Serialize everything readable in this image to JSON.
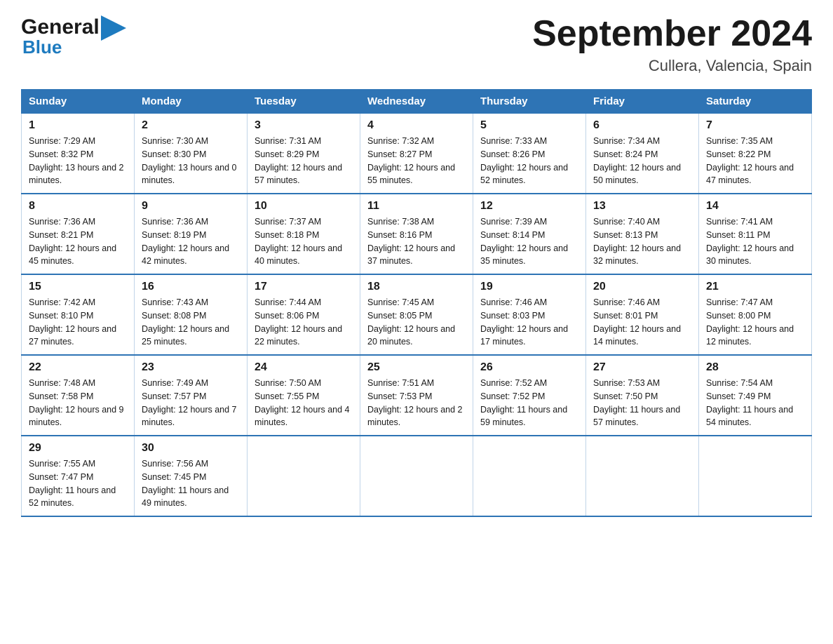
{
  "header": {
    "logo_general": "General",
    "logo_blue": "Blue",
    "title": "September 2024",
    "subtitle": "Cullera, Valencia, Spain"
  },
  "columns": [
    "Sunday",
    "Monday",
    "Tuesday",
    "Wednesday",
    "Thursday",
    "Friday",
    "Saturday"
  ],
  "weeks": [
    [
      {
        "day": "1",
        "sunrise": "7:29 AM",
        "sunset": "8:32 PM",
        "daylight": "13 hours and 2 minutes."
      },
      {
        "day": "2",
        "sunrise": "7:30 AM",
        "sunset": "8:30 PM",
        "daylight": "13 hours and 0 minutes."
      },
      {
        "day": "3",
        "sunrise": "7:31 AM",
        "sunset": "8:29 PM",
        "daylight": "12 hours and 57 minutes."
      },
      {
        "day": "4",
        "sunrise": "7:32 AM",
        "sunset": "8:27 PM",
        "daylight": "12 hours and 55 minutes."
      },
      {
        "day": "5",
        "sunrise": "7:33 AM",
        "sunset": "8:26 PM",
        "daylight": "12 hours and 52 minutes."
      },
      {
        "day": "6",
        "sunrise": "7:34 AM",
        "sunset": "8:24 PM",
        "daylight": "12 hours and 50 minutes."
      },
      {
        "day": "7",
        "sunrise": "7:35 AM",
        "sunset": "8:22 PM",
        "daylight": "12 hours and 47 minutes."
      }
    ],
    [
      {
        "day": "8",
        "sunrise": "7:36 AM",
        "sunset": "8:21 PM",
        "daylight": "12 hours and 45 minutes."
      },
      {
        "day": "9",
        "sunrise": "7:36 AM",
        "sunset": "8:19 PM",
        "daylight": "12 hours and 42 minutes."
      },
      {
        "day": "10",
        "sunrise": "7:37 AM",
        "sunset": "8:18 PM",
        "daylight": "12 hours and 40 minutes."
      },
      {
        "day": "11",
        "sunrise": "7:38 AM",
        "sunset": "8:16 PM",
        "daylight": "12 hours and 37 minutes."
      },
      {
        "day": "12",
        "sunrise": "7:39 AM",
        "sunset": "8:14 PM",
        "daylight": "12 hours and 35 minutes."
      },
      {
        "day": "13",
        "sunrise": "7:40 AM",
        "sunset": "8:13 PM",
        "daylight": "12 hours and 32 minutes."
      },
      {
        "day": "14",
        "sunrise": "7:41 AM",
        "sunset": "8:11 PM",
        "daylight": "12 hours and 30 minutes."
      }
    ],
    [
      {
        "day": "15",
        "sunrise": "7:42 AM",
        "sunset": "8:10 PM",
        "daylight": "12 hours and 27 minutes."
      },
      {
        "day": "16",
        "sunrise": "7:43 AM",
        "sunset": "8:08 PM",
        "daylight": "12 hours and 25 minutes."
      },
      {
        "day": "17",
        "sunrise": "7:44 AM",
        "sunset": "8:06 PM",
        "daylight": "12 hours and 22 minutes."
      },
      {
        "day": "18",
        "sunrise": "7:45 AM",
        "sunset": "8:05 PM",
        "daylight": "12 hours and 20 minutes."
      },
      {
        "day": "19",
        "sunrise": "7:46 AM",
        "sunset": "8:03 PM",
        "daylight": "12 hours and 17 minutes."
      },
      {
        "day": "20",
        "sunrise": "7:46 AM",
        "sunset": "8:01 PM",
        "daylight": "12 hours and 14 minutes."
      },
      {
        "day": "21",
        "sunrise": "7:47 AM",
        "sunset": "8:00 PM",
        "daylight": "12 hours and 12 minutes."
      }
    ],
    [
      {
        "day": "22",
        "sunrise": "7:48 AM",
        "sunset": "7:58 PM",
        "daylight": "12 hours and 9 minutes."
      },
      {
        "day": "23",
        "sunrise": "7:49 AM",
        "sunset": "7:57 PM",
        "daylight": "12 hours and 7 minutes."
      },
      {
        "day": "24",
        "sunrise": "7:50 AM",
        "sunset": "7:55 PM",
        "daylight": "12 hours and 4 minutes."
      },
      {
        "day": "25",
        "sunrise": "7:51 AM",
        "sunset": "7:53 PM",
        "daylight": "12 hours and 2 minutes."
      },
      {
        "day": "26",
        "sunrise": "7:52 AM",
        "sunset": "7:52 PM",
        "daylight": "11 hours and 59 minutes."
      },
      {
        "day": "27",
        "sunrise": "7:53 AM",
        "sunset": "7:50 PM",
        "daylight": "11 hours and 57 minutes."
      },
      {
        "day": "28",
        "sunrise": "7:54 AM",
        "sunset": "7:49 PM",
        "daylight": "11 hours and 54 minutes."
      }
    ],
    [
      {
        "day": "29",
        "sunrise": "7:55 AM",
        "sunset": "7:47 PM",
        "daylight": "11 hours and 52 minutes."
      },
      {
        "day": "30",
        "sunrise": "7:56 AM",
        "sunset": "7:45 PM",
        "daylight": "11 hours and 49 minutes."
      },
      null,
      null,
      null,
      null,
      null
    ]
  ]
}
